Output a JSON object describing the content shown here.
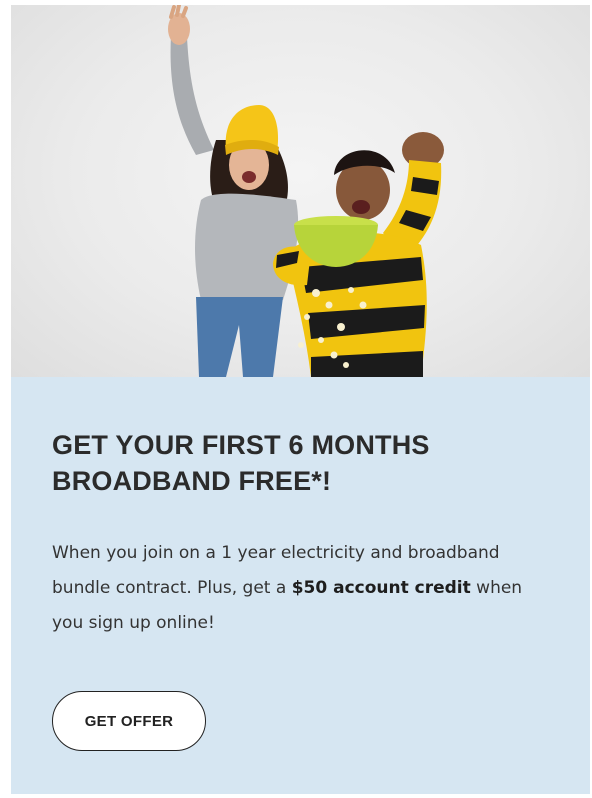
{
  "promo": {
    "headline_line1": "GET YOUR FIRST 6 MONTHS",
    "headline_line2": "BROADBAND FREE*!",
    "body_part1": "When you join on a 1 year electricity and broadband bundle contract. Plus, get a ",
    "body_bold": "$50 account credit",
    "body_part2": " when you sign up online!",
    "cta_label": "GET OFFER"
  },
  "colors": {
    "panel_background": "#d6e6f2",
    "button_background": "#ffffff",
    "text": "#2b2b2b",
    "accent_yellow": "#f5c518"
  }
}
